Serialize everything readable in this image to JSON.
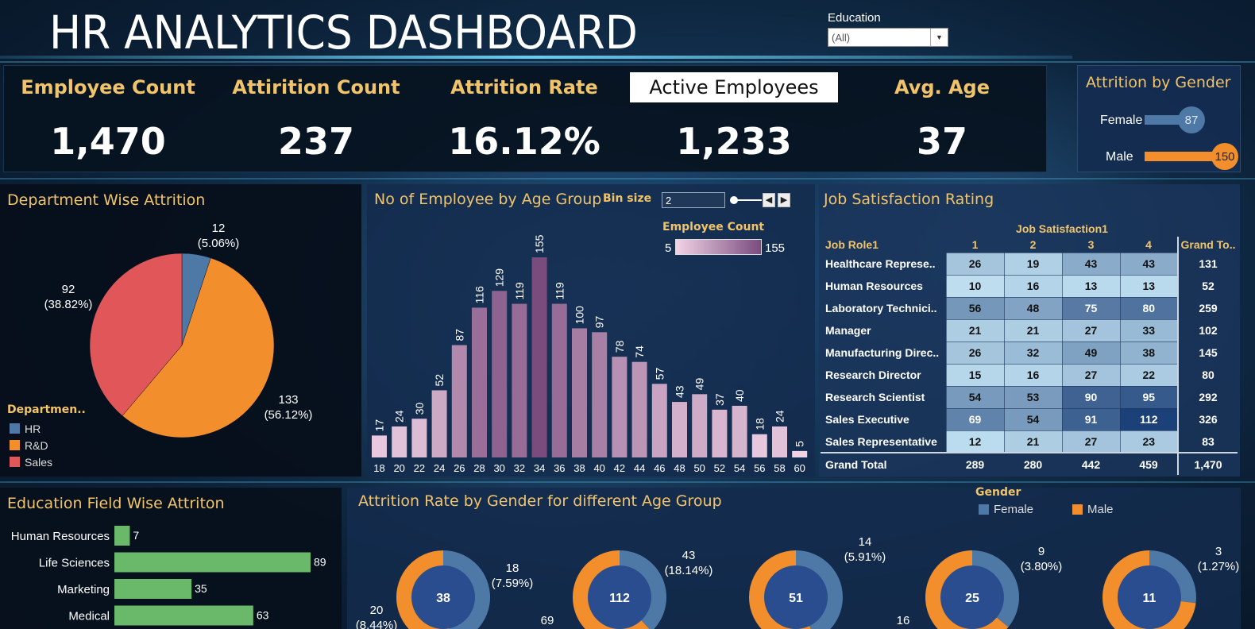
{
  "header": {
    "title": "HR ANALYTICS DASHBOARD",
    "filter_label": "Education",
    "filter_value": "(All)"
  },
  "kpis": [
    {
      "label": "Employee Count",
      "value": "1,470"
    },
    {
      "label": "Attirition  Count",
      "value": "237"
    },
    {
      "label": "Attrition Rate",
      "value": "16.12%"
    },
    {
      "label": "Active Employees",
      "value": "1,233"
    },
    {
      "label": "Avg. Age",
      "value": "37"
    }
  ],
  "gender_attrition": {
    "title": "Attrition by Gender",
    "rows": [
      {
        "label": "Female",
        "value": "87",
        "color": "#4e79a7"
      },
      {
        "label": "Male",
        "value": "150",
        "color": "#f28e2b"
      }
    ]
  },
  "department": {
    "title": "Department  Wise Attrition",
    "legend_title": "Departmen..",
    "chart_data": {
      "type": "pie",
      "slices": [
        {
          "label": "HR",
          "value": 12,
          "pct": "(5.06%)",
          "color": "#4e79a7"
        },
        {
          "label": "R&D",
          "value": 133,
          "pct": "(56.12%)",
          "color": "#f28e2b"
        },
        {
          "label": "Sales",
          "value": 92,
          "pct": "(38.82%)",
          "color": "#e15759"
        }
      ]
    }
  },
  "age_group": {
    "title": "No of Employee by Age Group",
    "bin_label": "Bin size",
    "bin_value": "2",
    "legend_title": "Employee Count",
    "legend_min": "5",
    "legend_max": "155",
    "chart_data": {
      "type": "bar",
      "categories": [
        "18",
        "20",
        "22",
        "24",
        "26",
        "28",
        "30",
        "32",
        "34",
        "36",
        "38",
        "40",
        "42",
        "44",
        "46",
        "48",
        "50",
        "52",
        "54",
        "56",
        "58",
        "60"
      ],
      "values": [
        17,
        24,
        30,
        52,
        87,
        116,
        129,
        119,
        155,
        119,
        100,
        97,
        78,
        74,
        57,
        43,
        49,
        37,
        40,
        18,
        24,
        5
      ],
      "ylim": [
        0,
        155
      ]
    }
  },
  "job_satisfaction": {
    "title": "Job Satisfaction Rating",
    "column_group": "Job Satisfaction1",
    "row_header": "Job Role1",
    "columns": [
      "1",
      "2",
      "3",
      "4"
    ],
    "grand_total_header": "Grand To..",
    "rows": [
      {
        "role": "Healthcare Represe..",
        "values": [
          "26",
          "19",
          "43",
          "43"
        ],
        "total": "131"
      },
      {
        "role": "Human Resources",
        "values": [
          "10",
          "16",
          "13",
          "13"
        ],
        "total": "52"
      },
      {
        "role": "Laboratory Technici..",
        "values": [
          "56",
          "48",
          "75",
          "80"
        ],
        "total": "259"
      },
      {
        "role": "Manager",
        "values": [
          "21",
          "21",
          "27",
          "33"
        ],
        "total": "102"
      },
      {
        "role": "Manufacturing Direc..",
        "values": [
          "26",
          "32",
          "49",
          "38"
        ],
        "total": "145"
      },
      {
        "role": "Research Director",
        "values": [
          "15",
          "16",
          "27",
          "22"
        ],
        "total": "80"
      },
      {
        "role": "Research Scientist",
        "values": [
          "54",
          "53",
          "90",
          "95"
        ],
        "total": "292"
      },
      {
        "role": "Sales Executive",
        "values": [
          "69",
          "54",
          "91",
          "112"
        ],
        "total": "326"
      },
      {
        "role": "Sales Representative",
        "values": [
          "12",
          "21",
          "27",
          "23"
        ],
        "total": "83"
      }
    ],
    "grand_total": {
      "label": "Grand Total",
      "values": [
        "289",
        "280",
        "442",
        "459"
      ],
      "total": "1,470"
    }
  },
  "education_field": {
    "title": "Education Field Wise Attriton",
    "chart_data": {
      "type": "bar",
      "categories": [
        "Human Resources",
        "Life Sciences",
        "Marketing",
        "Medical"
      ],
      "values": [
        7,
        89,
        35,
        63
      ],
      "color": "#6ab96a"
    }
  },
  "age_gender_rate": {
    "title": "Attrition Rate  by  Gender for different Age Group",
    "legend_title": "Gender",
    "legend": [
      {
        "label": "Female",
        "color": "#4e79a7"
      },
      {
        "label": "Male",
        "color": "#f28e2b"
      }
    ],
    "donuts": [
      {
        "center": "38",
        "label": "18",
        "pct": "(7.59%)",
        "extra_label": "20",
        "extra_pct": "(8.44%)",
        "female_frac": 0.47
      },
      {
        "center": "112",
        "label": "43",
        "pct": "(18.14%)",
        "extra_label": "69",
        "female_frac": 0.38
      },
      {
        "center": "51",
        "label": "14",
        "pct": "(5.91%)",
        "extra_label": "16",
        "female_frac": 0.43
      },
      {
        "center": "25",
        "label": "9",
        "pct": "(3.80%)",
        "female_frac": 0.36
      },
      {
        "center": "11",
        "label": "3",
        "pct": "(1.27%)",
        "female_frac": 0.27
      }
    ]
  }
}
